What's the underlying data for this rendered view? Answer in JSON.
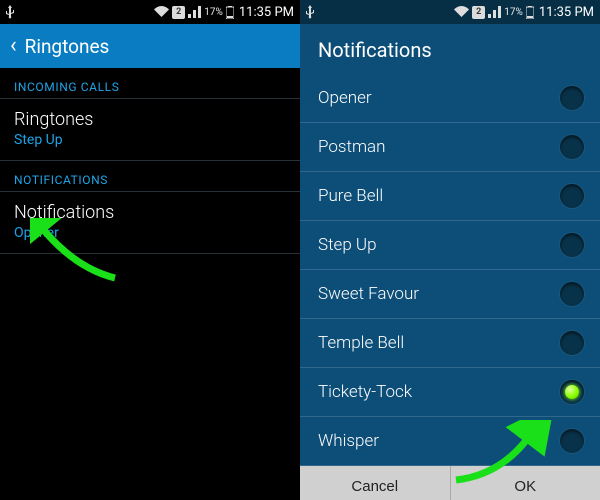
{
  "status": {
    "battery_pct": "17%",
    "time": "11:35 PM"
  },
  "left": {
    "title": "Ringtones",
    "sections": [
      {
        "header": "INCOMING CALLS",
        "item": {
          "title": "Ringtones",
          "subtitle": "Step Up"
        }
      },
      {
        "header": "NOTIFICATIONS",
        "item": {
          "title": "Notifications",
          "subtitle": "Opener"
        }
      }
    ]
  },
  "right": {
    "dialog_title": "Notifications",
    "options": [
      {
        "label": "Opener",
        "selected": false
      },
      {
        "label": "Postman",
        "selected": false
      },
      {
        "label": "Pure Bell",
        "selected": false
      },
      {
        "label": "Step Up",
        "selected": false
      },
      {
        "label": "Sweet Favour",
        "selected": false
      },
      {
        "label": "Temple Bell",
        "selected": false
      },
      {
        "label": "Tickety-Tock",
        "selected": true
      },
      {
        "label": "Whisper",
        "selected": false
      }
    ],
    "buttons": {
      "cancel": "Cancel",
      "ok": "OK"
    }
  }
}
